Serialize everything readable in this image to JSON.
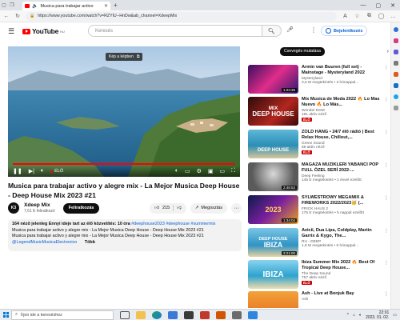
{
  "browser": {
    "tab_title": "Musica para trabajar activo",
    "url": "https://www.youtube.com/watch?v=RZYlU--HnDw&ab_channel=XdeepMix"
  },
  "youtube": {
    "logo_text": "YouTube",
    "country_code": "HU",
    "search_placeholder": "Keresés",
    "signin_label": "Bejelentkezés"
  },
  "player": {
    "watch_later_label": "Kép a képben",
    "live_label": "ÉLŐ"
  },
  "video": {
    "title": "Musica para trabajar activo y alegre mix - La Mejor Musica Deep House - Deep House Mix 2023 #21",
    "channel_name": "Xdeep Mix",
    "channel_initials": "K3",
    "subscribers": "7,61 E feliratkozó",
    "subscribe_label": "Feliratkozás",
    "likes": "215",
    "share_label": "Megosztás",
    "desc_line1_views": "164 néző jelenleg  Ennyi ideje tart az élő közvetítés: 10 óra",
    "desc_line1_tags": " #deephouse2023 #deephouse #summermix",
    "desc_line2": "Musica para trabajar activo y alegre mix - La Mejor Musica Deep House - Deep House Mix 2023 #21",
    "desc_line3": "Musica para trabajar activo y alegre mix - La Mejor Musica Deep House - Deep House Mix 2023 #21",
    "desc_link": "@LegendMusicMusicaElectronico",
    "desc_more": "Több"
  },
  "chips": {
    "active": "Csevegés mutatása"
  },
  "recommendations": [
    {
      "title": "Armin van Buuren (full set) - Mainstage - Mysteryland 2022",
      "channel": "Mysteryland",
      "meta": "3,5 M megtekintés • 3 hónappal...",
      "badge": "1:23:36",
      "live": false
    },
    {
      "title": "Mix Musica de Moda 2022 🔥 Lo Mas Nuevo 🔥 Lo Más...",
      "channel": "Wonder EDM",
      "meta": "181 aktív néző",
      "badge": "ÉLŐ",
      "live": true
    },
    {
      "title": "ZÖLD HANG • 24/7 élő rádió | Best Relax House, Chillout,...",
      "channel": "Green Sound",
      "meta": "69 aktív néző",
      "badge": "ÉLŐ",
      "live": true
    },
    {
      "title": "MAGAZA MÜZİKLERİ YABANCI POP FULL ÖZEL SERİ 2022-...",
      "channel": "Deep Feeling",
      "meta": "145 E megtekintés • 1 évvel ezelőtt",
      "badge": "2:48:53",
      "live": false
    },
    {
      "title": "SYLWESTROWY MEGAMIX & FIREWORKS 2022/2023🥳 (...",
      "channel": "FRICK HAUS 2",
      "meta": "175 E megtekintés • 5 nappal ezelőtt",
      "badge": "1:34:04",
      "live": false
    },
    {
      "title": "Avicii, Dua Lipa, Coldplay, Martin Garrix & Kygo, The...",
      "channel": "RU - DEEP",
      "meta": "1,8 M megtekintés • 5 hónappal...",
      "badge": "3:21:00",
      "live": false
    },
    {
      "title": "Ibiza Summer Mix 2022 🔥 Best Of Tropical Deep House...",
      "channel": "The Deep Sound",
      "meta": "757 aktív néző",
      "badge": "ÉLŐ",
      "live": true
    },
    {
      "title": "Ash - Live at Bonjuk Bay",
      "channel": "Ash",
      "meta": "",
      "badge": "",
      "live": false
    }
  ],
  "thumb_text": {
    "t2_top": "MIX",
    "t2_bottom": "DEEP HOUSE",
    "t3": "DEEP HOUSE",
    "t5": "2023",
    "t6_top": "DEEP HOUSE",
    "t6_bottom": "IBIZA",
    "t7": "IBIZA"
  },
  "taskbar": {
    "search_placeholder": "Írjon ide a kereséshez",
    "time": "22:01",
    "date": "2023. 01. 02."
  },
  "colors": {
    "youtube_red": "#ff0000",
    "link_blue": "#065fd4",
    "live_red": "#cc0000"
  }
}
